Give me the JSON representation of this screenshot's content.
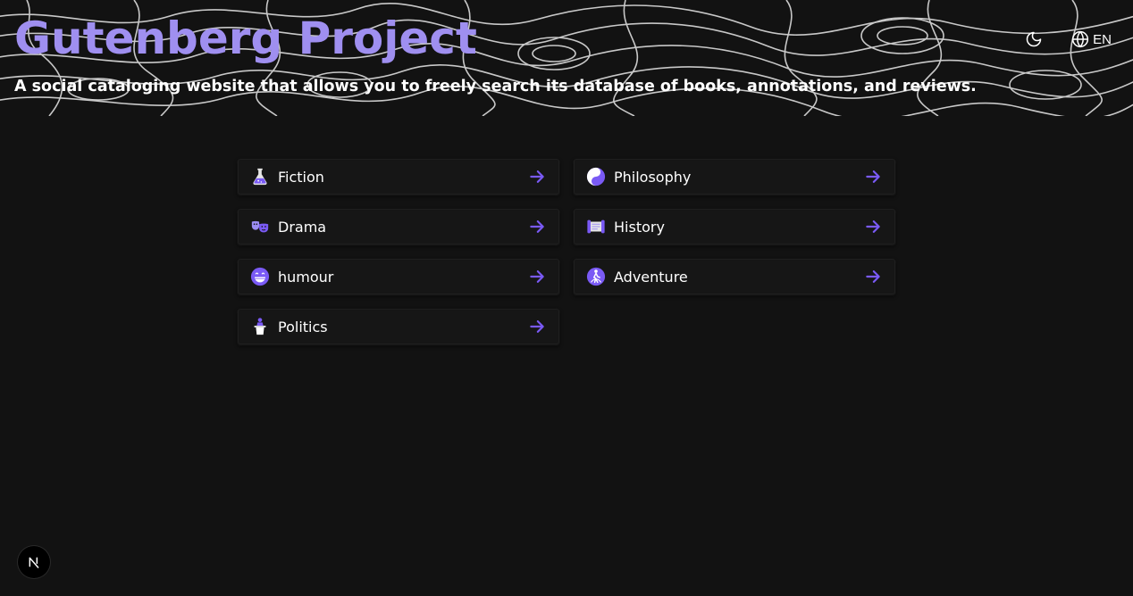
{
  "header": {
    "title": "Gutenberg Project",
    "subtitle": "A social cataloging website that allows you to freely search its database of books, annotations, and reviews.",
    "language": "EN",
    "theme_toggle_icon": "moon-icon",
    "language_icon": "globe-icon"
  },
  "categories": [
    {
      "label": "Fiction",
      "icon": "flask-icon"
    },
    {
      "label": "Philosophy",
      "icon": "yin-yang-icon"
    },
    {
      "label": "Drama",
      "icon": "theater-masks-icon"
    },
    {
      "label": "History",
      "icon": "scroll-icon"
    },
    {
      "label": "humour",
      "icon": "grin-icon"
    },
    {
      "label": "Adventure",
      "icon": "hiker-icon"
    },
    {
      "label": "Politics",
      "icon": "podium-icon"
    }
  ],
  "colors": {
    "accent": "#9f8ff0",
    "icon_accent": "#7a5af5",
    "background": "#121212",
    "card_background": "#161616",
    "text": "#ffffff"
  },
  "footer": {
    "dev_badge_icon": "nextjs-icon"
  }
}
